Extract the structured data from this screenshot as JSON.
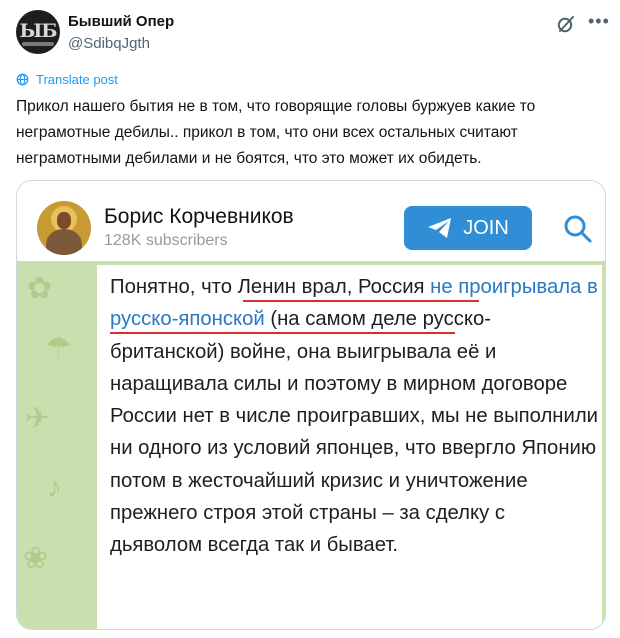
{
  "post": {
    "author_name": "Бывший Опер",
    "author_handle": "@SdibqJgth",
    "avatar_glyph": "ЫБ",
    "translate_label": "Translate post",
    "text": "Прикол нашего бытия не в том, что говорящие головы буржуев какие то неграмотные дебилы.. прикол в том, что они всех остальных считают неграмотными дебилами и не боятся, что это может их обидеть."
  },
  "telegram": {
    "channel_name": "Борис Корчевников",
    "subscribers": "128K subscribers",
    "join_label": "JOIN",
    "accent_color": "#2f8ed6",
    "message": {
      "part1": "Понятно, что ",
      "part2": "Ленин врал, Россия ",
      "part3": "не проигрывала в русско-японской",
      "part4": " (на самом деле русско-британской) войне, она выигрывала её и наращивала силы и поэтому в мирном договоре России нет в числе проигравших, мы не выполнили ни одного из условий японцев, что ввергло Японию потом в жесточайший кризис и уничтожение прежнего строя этой страны – за сделку с дьяволом всегда так и бывает."
    }
  },
  "icons": {
    "grok": "grok-icon",
    "more": "more-icon",
    "translate": "globe-icon",
    "join": "telegram-plane-icon",
    "search": "search-icon"
  }
}
